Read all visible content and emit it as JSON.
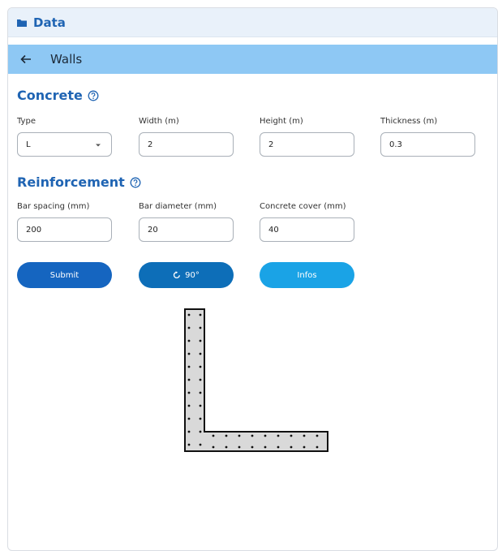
{
  "header": {
    "title": "Data",
    "folder_icon": "folder-icon"
  },
  "nav": {
    "title": "Walls",
    "back_icon": "arrow-left-icon"
  },
  "concrete": {
    "title": "Concrete",
    "help_icon": "help-circle-icon",
    "fields": {
      "type": {
        "label": "Type",
        "value": "L"
      },
      "width": {
        "label": "Width (m)",
        "value": "2"
      },
      "height": {
        "label": "Height (m)",
        "value": "2"
      },
      "thickness": {
        "label": "Thickness (m)",
        "value": "0.3"
      }
    }
  },
  "reinforcement": {
    "title": "Reinforcement",
    "help_icon": "help-circle-icon",
    "fields": {
      "bar_spacing": {
        "label": "Bar spacing (mm)",
        "value": "200"
      },
      "bar_diameter": {
        "label": "Bar diameter (mm)",
        "value": "20"
      },
      "concrete_cover": {
        "label": "Concrete cover (mm)",
        "value": "40"
      }
    }
  },
  "buttons": {
    "submit": {
      "label": "Submit",
      "color": "#1565c0"
    },
    "rotate": {
      "label": "90°",
      "icon": "rotate-icon",
      "color": "#0d6eb8"
    },
    "infos": {
      "label": "Infos",
      "color": "#1aa3e6"
    }
  },
  "colors": {
    "accent": "#1f64b3",
    "nav_bg": "#8ec8f4",
    "header_bg": "#e9f1fa",
    "section_fill": "#d9d9d9"
  }
}
